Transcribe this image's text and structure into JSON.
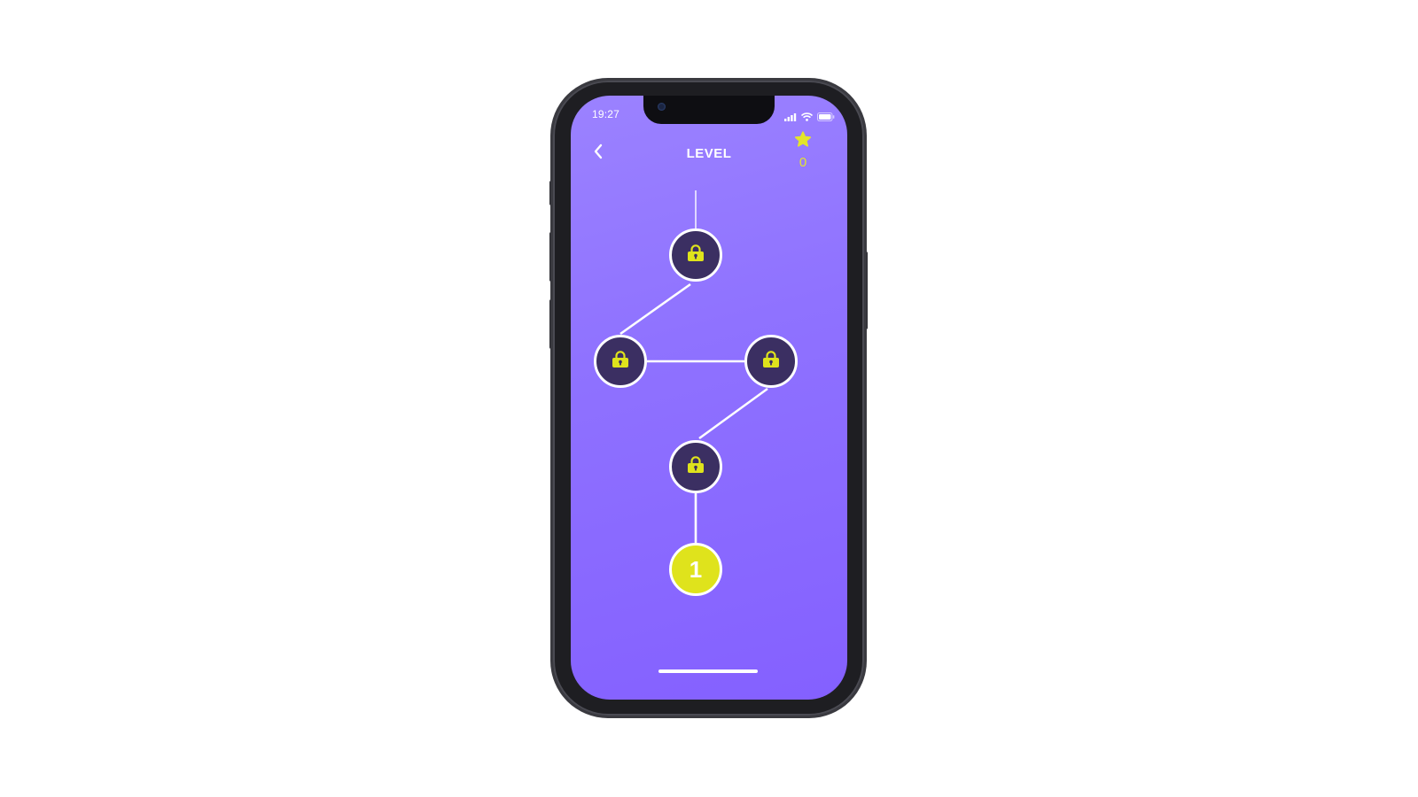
{
  "status_bar": {
    "time": "19:27"
  },
  "header": {
    "title": "LEVEL",
    "back_icon": "chevron-left-icon",
    "star_icon": "star-icon",
    "star_count": "0"
  },
  "levels": [
    {
      "label": "",
      "state": "locked",
      "icon": "lock-icon"
    },
    {
      "label": "",
      "state": "locked",
      "icon": "lock-icon"
    },
    {
      "label": "",
      "state": "locked",
      "icon": "lock-icon"
    },
    {
      "label": "",
      "state": "locked",
      "icon": "lock-icon"
    },
    {
      "label": "1",
      "state": "unlocked"
    }
  ],
  "colors": {
    "background_top": "#9b82ff",
    "background_bottom": "#8460ff",
    "locked_node": "#3b2f62",
    "accent_yellow": "#dfe31c",
    "star_yellow": "#e3e52a"
  }
}
